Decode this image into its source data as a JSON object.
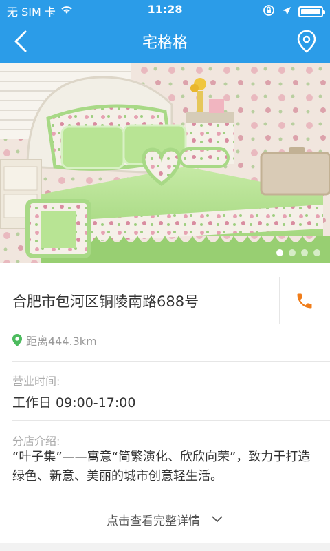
{
  "status_bar": {
    "carrier": "无 SIM 卡",
    "time": "11:28"
  },
  "nav": {
    "title": "宅格格"
  },
  "banner": {
    "page_count": 4,
    "active_index": 0
  },
  "store": {
    "address": "合肥市包河区铜陵南路688号",
    "distance": "距离444.3km",
    "hours_label": "营业时间:",
    "hours_value": "工作日 09:00-17:00",
    "intro_label": "分店介绍:",
    "intro_text": "“叶子集”——寓意“简繁演化、欣欣向荣”，致力于打造绿色、新意、美丽的城市创意轻生活。",
    "more_link": "点击查看完整详情"
  },
  "colors": {
    "brand_blue": "#2b9ce8",
    "phone_orange": "#f07d1a",
    "location_green": "#4cbb5e"
  },
  "icons": [
    "wifi-icon",
    "lock-rotation-icon",
    "location-arrow-icon",
    "battery-icon",
    "back-chevron-icon",
    "location-pin-icon",
    "phone-icon",
    "map-pin-icon",
    "chevron-down-icon"
  ]
}
